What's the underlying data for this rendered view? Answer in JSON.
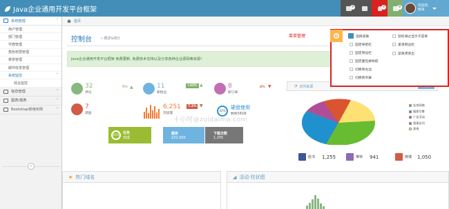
{
  "app": {
    "title": "Java企业通用开发平台框架"
  },
  "navbar": {
    "badges": [
      {
        "value": "8",
        "color": "#555555"
      },
      {
        "value": "8",
        "color": "#d9221f"
      },
      {
        "value": "8",
        "color": "#82af6f"
      }
    ],
    "user": {
      "line1": "欢迎您,",
      "line2": "杨涛"
    }
  },
  "sidebar": {
    "items": [
      {
        "label": "系统管理"
      },
      {
        "label": "用户管理"
      },
      {
        "label": "部门管理"
      },
      {
        "label": "字典管理"
      },
      {
        "label": "角色权限管理"
      },
      {
        "label": "菜单管理"
      },
      {
        "label": "邮件收发管理"
      },
      {
        "label": "系统监控"
      },
      {
        "label": "综合监控"
      },
      {
        "label": "信息管理"
      },
      {
        "label": "图表/报表"
      },
      {
        "label": "Bootstrap常用实例"
      }
    ],
    "collapse": "«"
  },
  "breadcrumb": {
    "home": "首页"
  },
  "header": {
    "title": "控制台",
    "subtitle": "» 概述&统计",
    "annotation": "菜单管理"
  },
  "alert": {
    "text": "Java企业通用开发平台框架 免费更新, 免费技术支持以及分享各种企业源码等资源!"
  },
  "stats": [
    {
      "num": "32",
      "label": "评论",
      "pct": "5%",
      "color": "#87b87f"
    },
    {
      "num": "11",
      "label": "新粉丝",
      "pct": "+32%",
      "color": "#6fb3e0"
    },
    {
      "num": "8",
      "label": "新订单",
      "pct": "4%",
      "color": "#c16fb2"
    },
    {
      "num": "7",
      "label": "调查",
      "color": "#d15b47"
    },
    {
      "num": "6,251",
      "label": "浏览量",
      "pct": "7.2%",
      "color": "#f27c35"
    },
    {
      "num": "硬盘使用",
      "label": "剩余58GB",
      "ring": "42%"
    }
  ],
  "tiles": [
    {
      "ring": "61%",
      "line1": "任务",
      "line2": "完成",
      "color": "#9abc32"
    },
    {
      "line1": "服务",
      "line2": "$32,000",
      "color": "#6fb3e0"
    },
    {
      "line1": "下载次数",
      "line2": "1,205",
      "color": "#777777"
    }
  ],
  "watermark": "十小吋@zuidaima.com",
  "visitor": {
    "title": "访问来源",
    "range": "本周",
    "legend": [
      {
        "label": "社交网络",
        "color": "#68bc31"
      },
      {
        "label": "搜索引擎",
        "color": "#2091cf"
      },
      {
        "label": "广告活动",
        "color": "#af4e96"
      },
      {
        "label": "直接访问",
        "color": "#da5430"
      },
      {
        "label": "其他",
        "color": "#fee074"
      }
    ],
    "social": [
      {
        "label": "脸书",
        "value": "1,255",
        "color": "#3b5998"
      },
      {
        "label": "推特",
        "value": "941",
        "color": "#8d6ab4"
      },
      {
        "label": "微博",
        "value": "1,050",
        "color": "#d15b47"
      }
    ]
  },
  "bottom": {
    "left_title": "热门域名",
    "right_title": "活动·柱状图"
  },
  "settings": {
    "options": [
      {
        "label": "选择皮肤"
      },
      {
        "label": "固定导航栏"
      },
      {
        "label": "固定侧边栏"
      },
      {
        "label": "固定面包屑导航"
      },
      {
        "label": "切换到左边"
      },
      {
        "label": "切换到窄屏"
      },
      {
        "label": "鼠标滑过显示子菜单"
      },
      {
        "label": "紧凑侧边栏"
      },
      {
        "label": "菜单项突出"
      }
    ]
  }
}
